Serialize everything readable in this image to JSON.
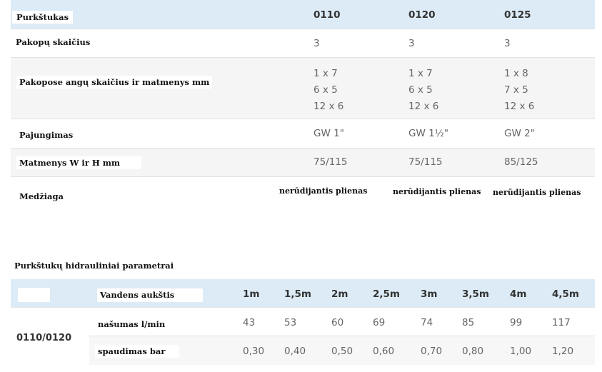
{
  "table1": {
    "header": {
      "label": "Purkštukas",
      "cols": [
        "0110",
        "0120",
        "0125"
      ]
    },
    "rows": [
      {
        "label": "Pakopų skaičius",
        "cols": [
          "3",
          "3",
          "3"
        ]
      },
      {
        "label": "Pakopose angų skaičius ir matmenys mm",
        "cols": [
          [
            "1 x 7",
            "6 x 5",
            "12 x 6"
          ],
          [
            "1 x 7",
            "6 x 5",
            "12 x 6"
          ],
          [
            "1 x 8",
            "7 x 5",
            "12 x 6"
          ]
        ]
      },
      {
        "label": "Pajungimas",
        "cols": [
          "GW 1\"",
          "GW 1½\"",
          "GW 2\""
        ]
      },
      {
        "label": "Matmenys W ir H mm",
        "cols": [
          "75/115",
          "75/115",
          "85/125"
        ]
      },
      {
        "label": "Medžiaga",
        "cols": [
          "nerūdijantis plienas",
          "nerūdijantis plienas",
          "nerūdijantis plienas"
        ]
      }
    ]
  },
  "table2": {
    "title": "Purkštukų hidrauliniai parametrai",
    "header": {
      "label": "Vandens aukštis",
      "cols": [
        "1m",
        "1,5m",
        "2m",
        "2,5m",
        "3m",
        "3,5m",
        "4m",
        "4,5m"
      ]
    },
    "group": "0110/0120",
    "rows": [
      {
        "label": "našumas l/min",
        "cols": [
          "43",
          "53",
          "60",
          "69",
          "74",
          "85",
          "99",
          "117"
        ]
      },
      {
        "label": "spaudimas bar",
        "cols": [
          "0,30",
          "0,40",
          "0,50",
          "0,60",
          "0,70",
          "0,80",
          "1,00",
          "1,20"
        ]
      }
    ]
  }
}
